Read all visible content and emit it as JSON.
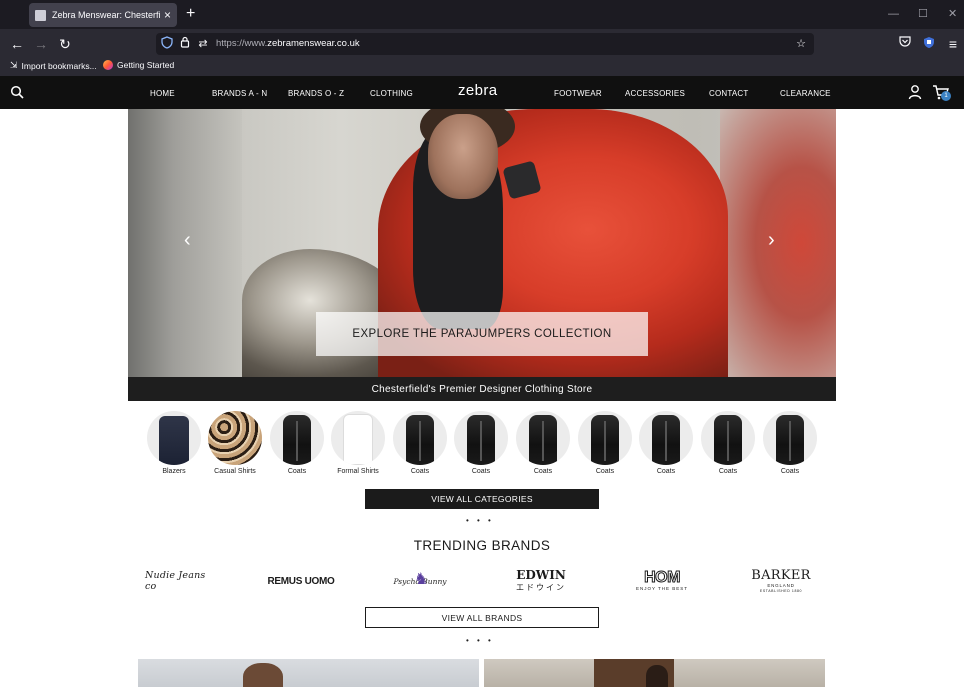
{
  "browser": {
    "tab_title": "Zebra Menswear: Chesterfield's",
    "url_prefix": "https://www.",
    "url_domain": "zebramenswear.co.uk",
    "bookmarks": [
      "Import bookmarks...",
      "Getting Started"
    ]
  },
  "header": {
    "menu_left": [
      "HOME",
      "BRANDS A - N",
      "BRANDS O - Z",
      "CLOTHING"
    ],
    "logo": "zebra",
    "menu_right": [
      "FOOTWEAR",
      "ACCESSORIES",
      "CONTACT",
      "CLEARANCE"
    ],
    "cart_count": "1"
  },
  "hero": {
    "cta": "EXPLORE THE PARAJUMPERS COLLECTION",
    "tagline": "Chesterfield's Premier Designer Clothing Store"
  },
  "categories": [
    "Blazers",
    "Casual Shirts",
    "Coats",
    "Formal Shirts",
    "Coats",
    "Coats",
    "Coats",
    "Coats",
    "Coats",
    "Coats",
    "Coats"
  ],
  "buttons": {
    "view_all_categories": "VIEW ALL CATEGORIES",
    "view_all_brands": "VIEW ALL BRANDS"
  },
  "trending": {
    "title": "TRENDING BRANDS",
    "brands": [
      "Nudie Jeans co",
      "REMUS UOMO",
      "Psycho Bunny",
      "EDWIN",
      "エドウイン",
      "HOM",
      "ENJOY THE BEST",
      "BARKER",
      "ENGLAND",
      "ESTABLISHED 1880"
    ]
  }
}
